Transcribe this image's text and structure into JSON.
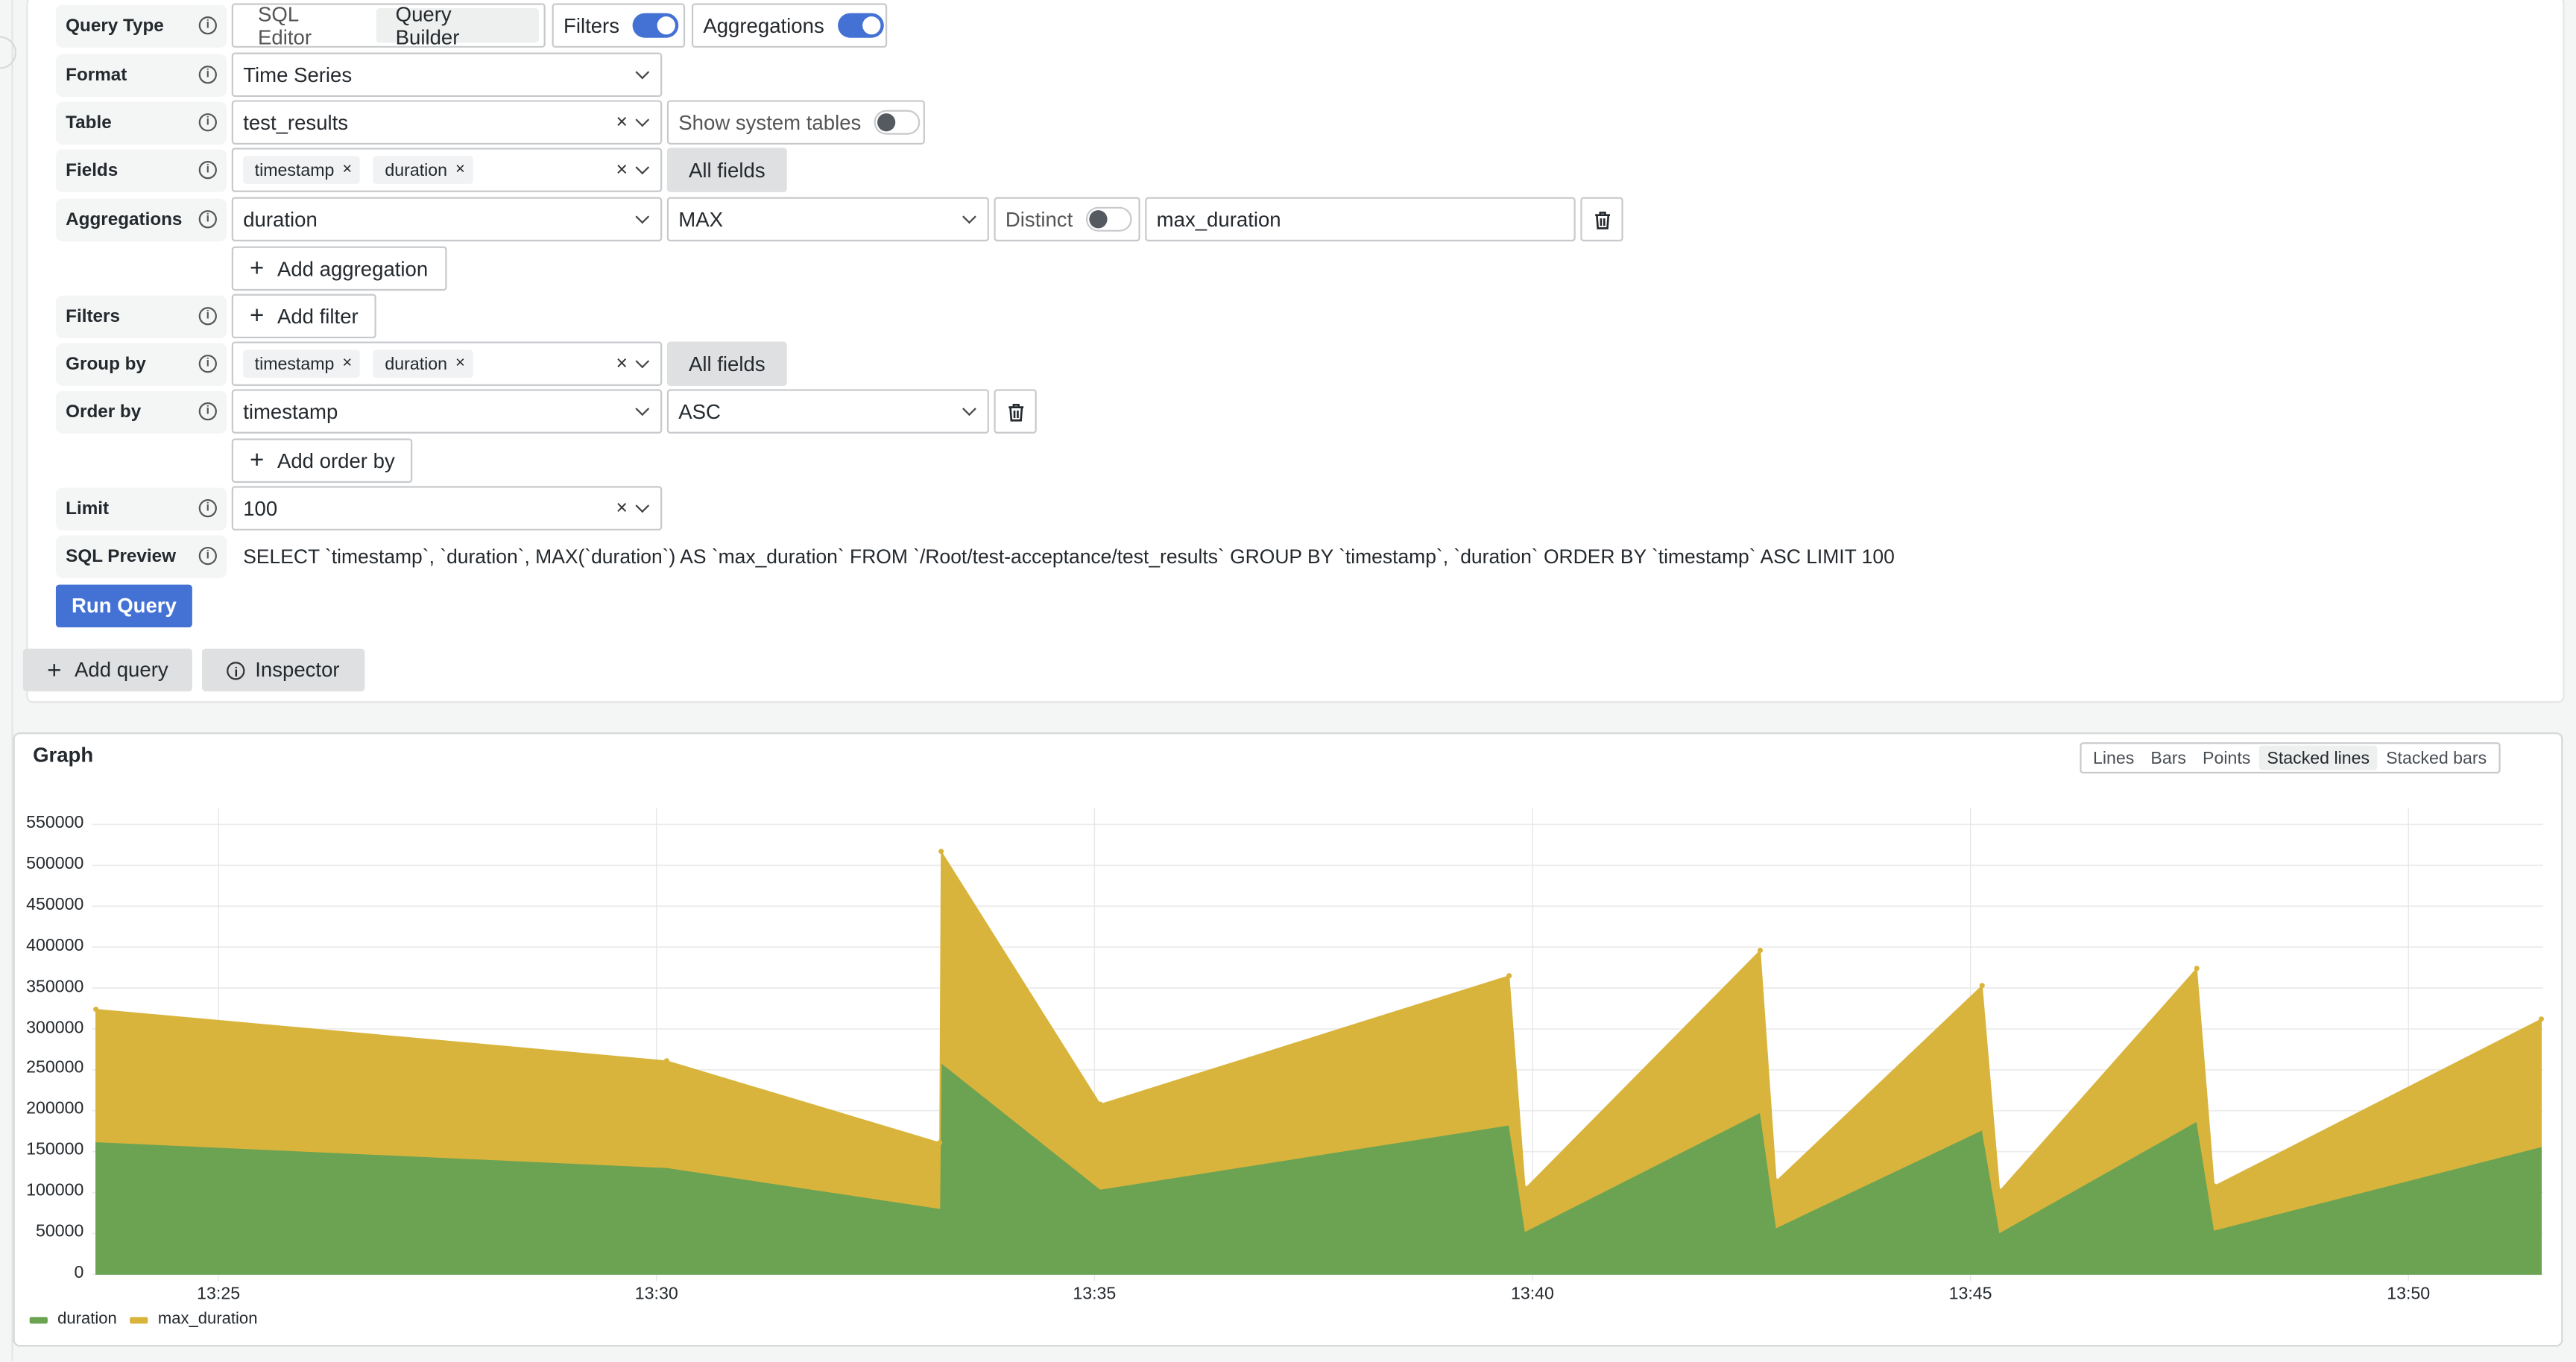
{
  "query_editor": {
    "rows": {
      "query_type": {
        "label": "Query Type",
        "modes": [
          "SQL Editor",
          "Query Builder"
        ],
        "active_mode": "Query Builder",
        "filters_toggle": {
          "label": "Filters",
          "on": true
        },
        "aggregations_toggle": {
          "label": "Aggregations",
          "on": true
        }
      },
      "format": {
        "label": "Format",
        "value": "Time Series"
      },
      "table": {
        "label": "Table",
        "value": "test_results",
        "show_system_tables": {
          "label": "Show system tables",
          "on": false
        }
      },
      "fields": {
        "label": "Fields",
        "chips": [
          "timestamp",
          "duration"
        ],
        "all_fields_label": "All fields"
      },
      "aggregations": {
        "label": "Aggregations",
        "field": "duration",
        "function": "MAX",
        "distinct": {
          "label": "Distinct",
          "on": false
        },
        "alias": "max_duration",
        "add_label": "Add aggregation"
      },
      "filters": {
        "label": "Filters",
        "add_label": "Add filter"
      },
      "group_by": {
        "label": "Group by",
        "chips": [
          "timestamp",
          "duration"
        ],
        "all_fields_label": "All fields"
      },
      "order_by": {
        "label": "Order by",
        "field": "timestamp",
        "direction": "ASC",
        "add_label": "Add order by"
      },
      "limit": {
        "label": "Limit",
        "value": "100"
      },
      "sql_preview": {
        "label": "SQL Preview",
        "value": "SELECT `timestamp`, `duration`, MAX(`duration`) AS `max_duration` FROM `/Root/test-acceptance/test_results` GROUP BY `timestamp`, `duration` ORDER BY `timestamp` ASC LIMIT 100"
      }
    },
    "run_query_label": "Run Query",
    "add_query_label": "Add query",
    "inspector_label": "Inspector",
    "colors": {
      "primary": "#4472d4"
    }
  },
  "graph": {
    "title": "Graph",
    "modes": [
      "Lines",
      "Bars",
      "Points",
      "Stacked lines",
      "Stacked bars"
    ],
    "active_mode": "Stacked lines"
  },
  "chart_data": {
    "type": "area",
    "stacked": true,
    "title": "Graph",
    "xlabel": "",
    "ylabel": "",
    "ylim": [
      0,
      550000
    ],
    "yticks": [
      "0",
      "50000",
      "100000",
      "150000",
      "200000",
      "250000",
      "300000",
      "350000",
      "400000",
      "450000",
      "500000",
      "550000"
    ],
    "xticks": [
      "13:25",
      "13:30",
      "13:35",
      "13:40",
      "13:45",
      "13:50"
    ],
    "x_range": [
      "13:23:36",
      "13:51:31"
    ],
    "grid": true,
    "legend": "bottom-left",
    "x": [
      "13:23:36",
      "13:30:07",
      "13:33:14",
      "13:33:15",
      "13:35:04",
      "13:39:44",
      "13:39:55",
      "13:42:36",
      "13:42:47",
      "13:45:08",
      "13:45:20",
      "13:47:35",
      "13:47:47",
      "13:51:31"
    ],
    "series": [
      {
        "name": "duration",
        "color": "#6ba353",
        "values": [
          162000,
          130500,
          80500,
          258500,
          104000,
          182500,
          52500,
          198000,
          57000,
          176500,
          51000,
          187000,
          54000,
          156000
        ]
      },
      {
        "name": "max_duration",
        "color": "#d9b43c",
        "values": [
          162000,
          130500,
          80500,
          258500,
          104000,
          182500,
          52500,
          198000,
          57000,
          176500,
          51000,
          187000,
          54000,
          156000
        ]
      }
    ]
  }
}
